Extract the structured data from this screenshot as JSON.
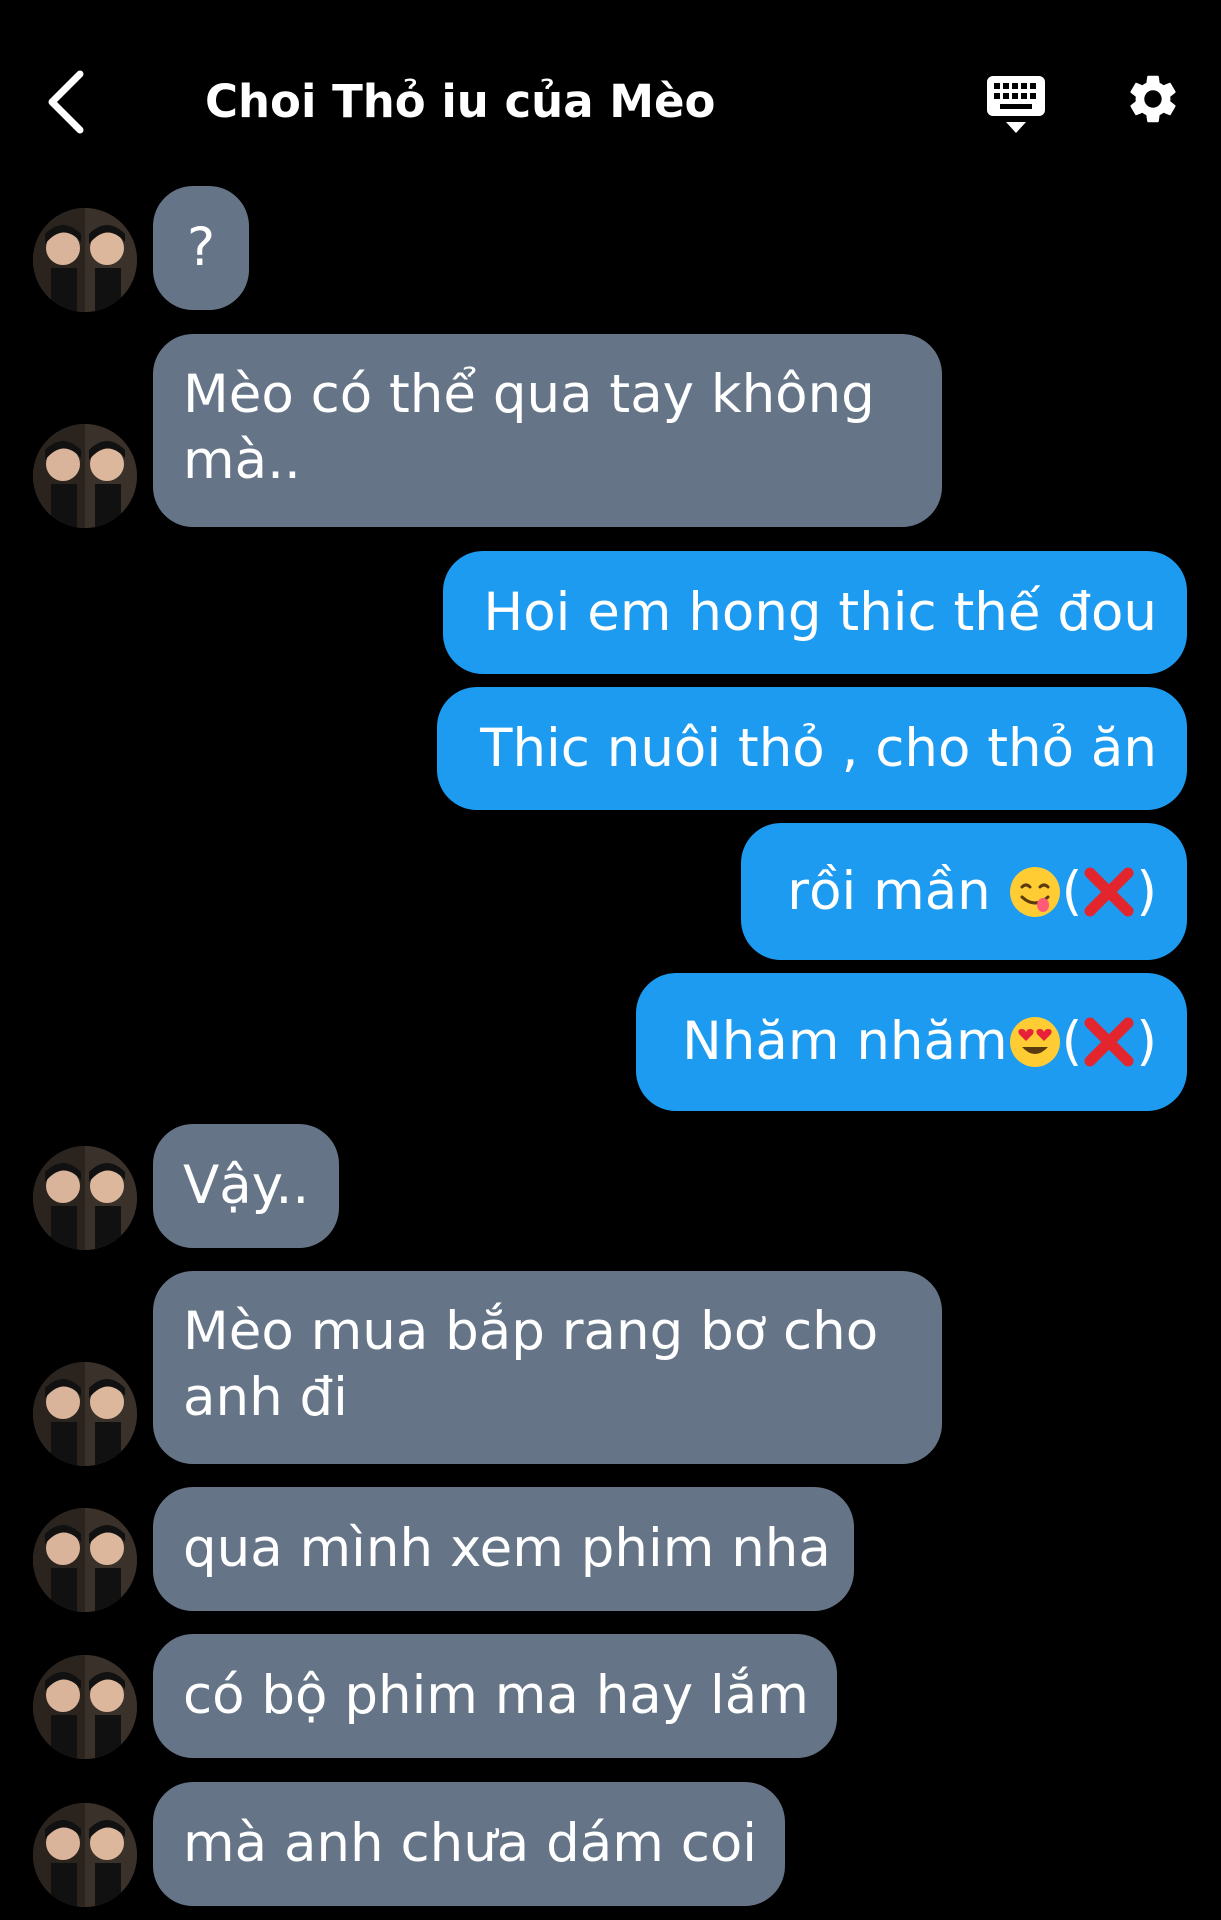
{
  "header": {
    "title": "Choi Thỏ iu của Mèo"
  },
  "icons": {
    "back": "chevron-left-icon",
    "keyboard": "keyboard-icon",
    "settings": "gear-icon"
  },
  "colors": {
    "incoming_bubble": "#657587",
    "outgoing_bubble": "#1d9bf0",
    "background": "#000000"
  },
  "messages": [
    {
      "side": "in",
      "lines": [
        "?"
      ]
    },
    {
      "side": "in",
      "lines": [
        "Mèo có thể qua tay không",
        "mà.."
      ]
    },
    {
      "side": "out",
      "lines": [
        "Hoi em hong thic thế đou"
      ]
    },
    {
      "side": "out",
      "lines": [
        "Thic nuôi thỏ , cho thỏ ăn"
      ]
    },
    {
      "side": "out",
      "text_before": "rồi mần ",
      "emoji": "savoring-face-emoji",
      "text_after": ")",
      "paren_open": "("
    },
    {
      "side": "out",
      "text_before": "Nhăm nhăm",
      "emoji": "heart-eyes-emoji",
      "text_after": ")",
      "paren_open": "("
    },
    {
      "side": "in",
      "lines": [
        "Vậy.."
      ]
    },
    {
      "side": "in",
      "lines": [
        "Mèo mua bắp rang bơ cho",
        "anh đi"
      ]
    },
    {
      "side": "in",
      "lines": [
        "qua mình xem phim nha"
      ]
    },
    {
      "side": "in",
      "lines": [
        "có bộ phim ma hay lắm"
      ]
    },
    {
      "side": "in",
      "lines": [
        "mà anh chưa dám coi"
      ]
    }
  ]
}
